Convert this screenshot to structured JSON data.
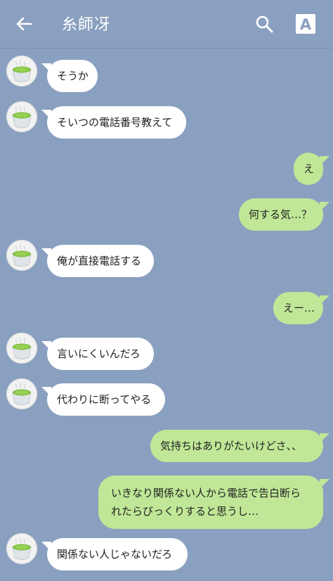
{
  "header": {
    "title": "糸師冴",
    "back_icon": "arrow-left-icon",
    "search_icon": "search-icon",
    "font_button_label": "A"
  },
  "messages": [
    {
      "side": "in",
      "text": "そうか"
    },
    {
      "side": "in",
      "text": "そいつの電話番号教えて"
    },
    {
      "side": "out",
      "text": "え"
    },
    {
      "side": "out",
      "text": "何する気…？"
    },
    {
      "side": "in",
      "text": "俺が直接電話する"
    },
    {
      "side": "out",
      "text": "えー…"
    },
    {
      "side": "in",
      "text": "言いにくいんだろ"
    },
    {
      "side": "in",
      "text": "代わりに断ってやる"
    },
    {
      "side": "out",
      "text": "気持ちはありがたいけどさ、、"
    },
    {
      "side": "out",
      "text": "いきなり関係ない人から電話で告白断られたらびっくりすると思うし…"
    },
    {
      "side": "in",
      "text": "関係ない人じゃないだろ"
    }
  ],
  "colors": {
    "background": "#8aa0c0",
    "incoming_bubble": "#ffffff",
    "outgoing_bubble": "#bfe797"
  }
}
